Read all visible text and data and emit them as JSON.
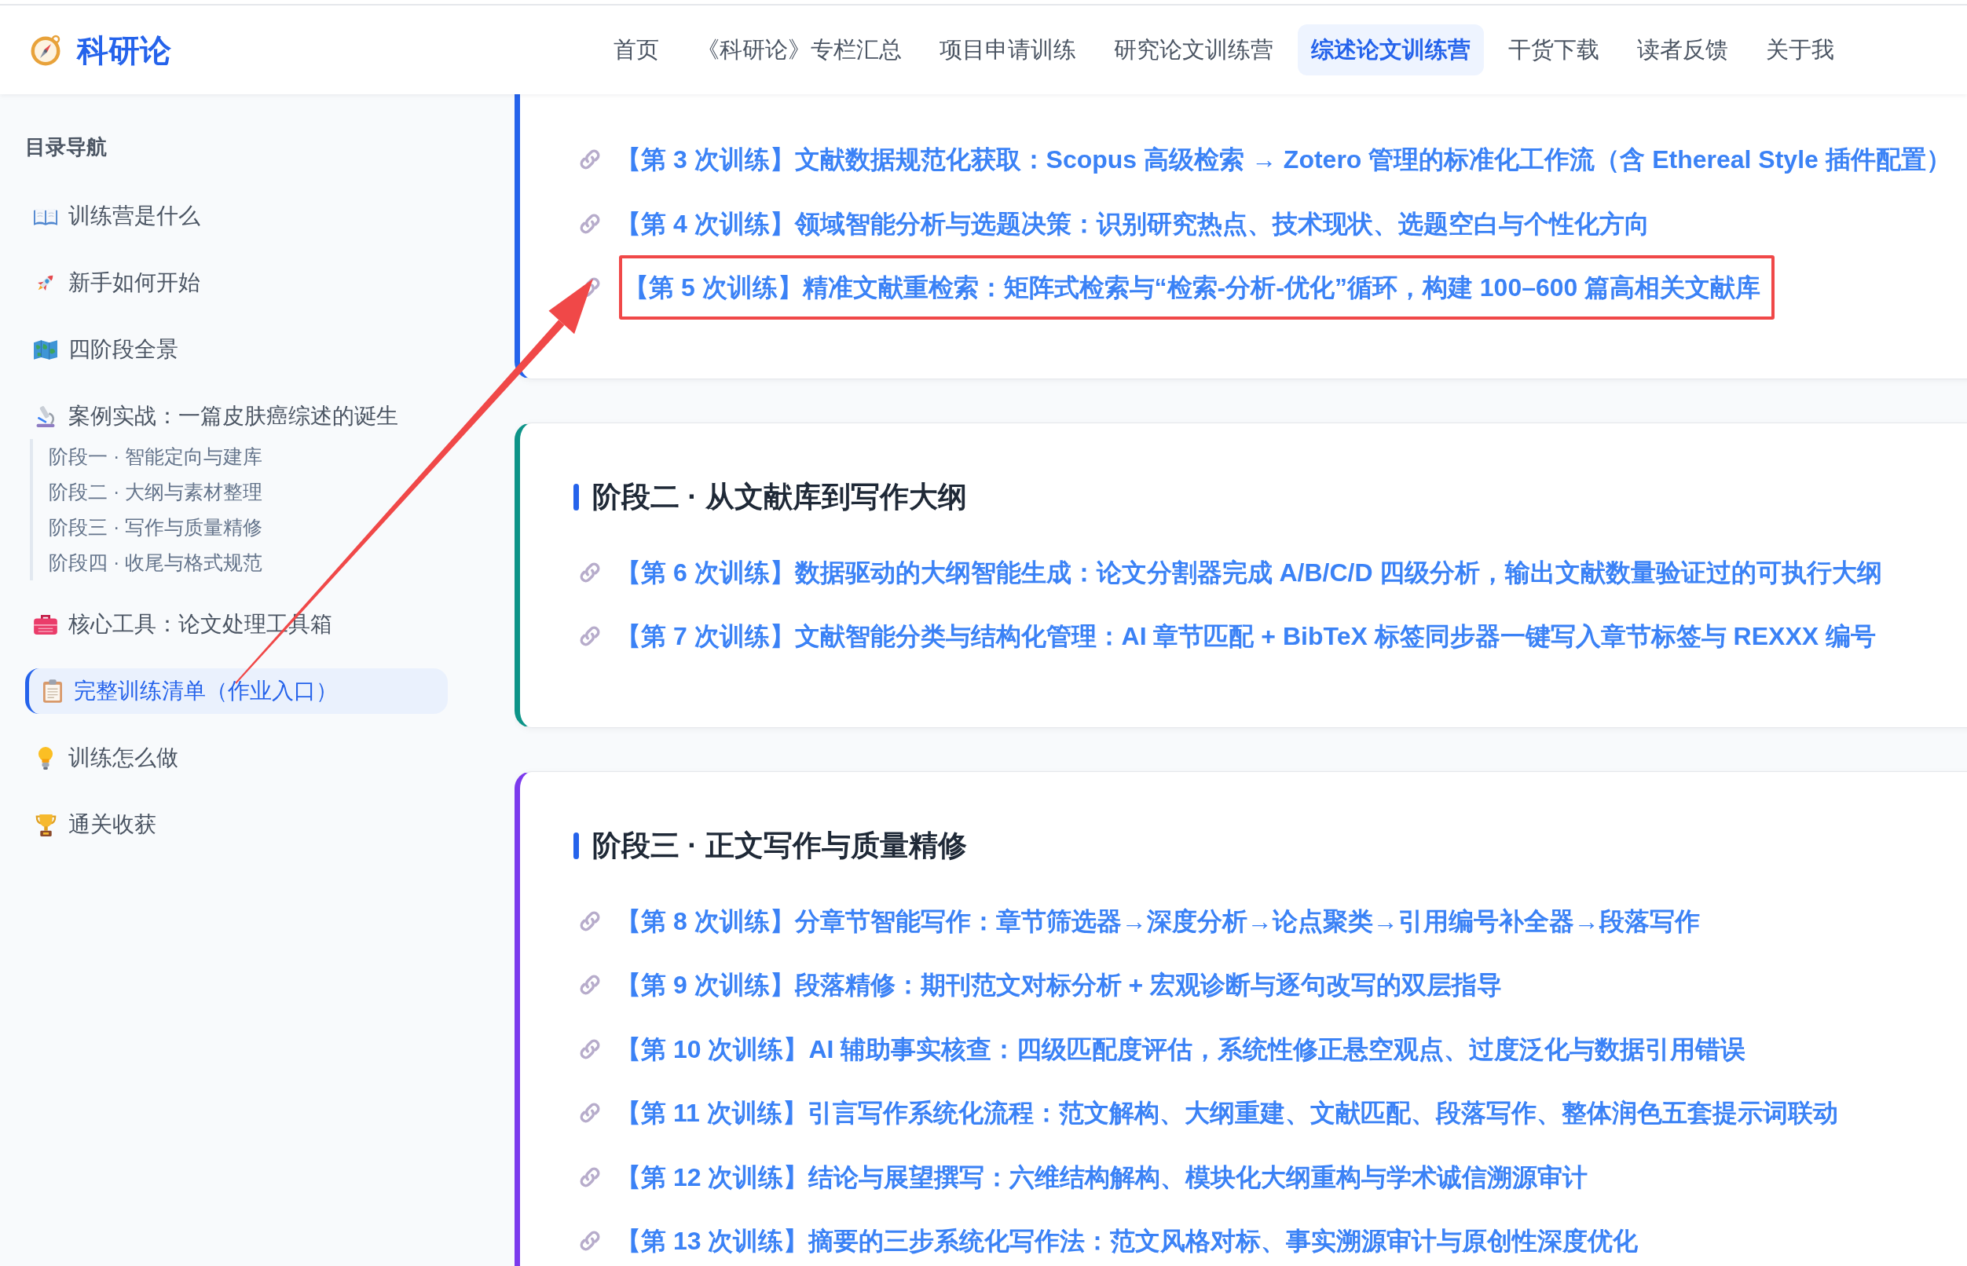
{
  "header": {
    "logo": "科研论",
    "nav": [
      {
        "label": "首页",
        "selected": false
      },
      {
        "label": "《科研论》专栏汇总",
        "selected": false
      },
      {
        "label": "项目申请训练",
        "selected": false
      },
      {
        "label": "研究论文训练营",
        "selected": false
      },
      {
        "label": "综述论文训练营",
        "selected": true
      },
      {
        "label": "干货下载",
        "selected": false
      },
      {
        "label": "读者反馈",
        "selected": false
      },
      {
        "label": "关于我",
        "selected": false
      }
    ]
  },
  "sidebar": {
    "title": "目录导航",
    "items": [
      {
        "label": "训练营是什么",
        "selected": false
      },
      {
        "label": "新手如何开始",
        "selected": false
      },
      {
        "label": "四阶段全景",
        "selected": false
      },
      {
        "label": "案例实战：一篇皮肤癌综述的诞生",
        "selected": false,
        "children": [
          {
            "label": "阶段一 · 智能定向与建库",
            "selected": false
          },
          {
            "label": "阶段二 · 大纲与素材整理",
            "selected": false
          },
          {
            "label": "阶段三 · 写作与质量精修",
            "selected": false
          },
          {
            "label": "阶段四 · 收尾与格式规范",
            "selected": false
          }
        ]
      },
      {
        "label": "核心工具：论文处理工具箱",
        "selected": false
      },
      {
        "label": "完整训练清单（作业入口）",
        "selected": true
      },
      {
        "label": "训练怎么做",
        "selected": false
      },
      {
        "label": "通关收获",
        "selected": false
      }
    ]
  },
  "stages": [
    {
      "color": "#2563eb",
      "links": [
        {
          "text": "【第 3 次训练】文献数据规范化获取：Scopus 高级检索 → Zotero 管理的标准化工作流（含 Ethereal Style 插件配置）",
          "highlighted": false
        },
        {
          "text": "【第 4 次训练】领域智能分析与选题决策：识别研究热点、技术现状、选题空白与个性化方向",
          "highlighted": false
        },
        {
          "text": "【第 5 次训练】精准文献重检索：矩阵式检索与“检索-分析-优化”循环，构建 100–600 篇高相关文献库",
          "highlighted": true
        }
      ]
    },
    {
      "title": "阶段二 · 从文献库到写作大纲",
      "color": "#0d9488",
      "links": [
        {
          "text": "【第 6 次训练】数据驱动的大纲智能生成：论文分割器完成 A/B/C/D 四级分析，输出文献数量验证过的可执行大纲",
          "highlighted": false
        },
        {
          "text": "【第 7 次训练】文献智能分类与结构化管理：AI 章节匹配 + BibTeX 标签同步器一键写入章节标签与 REXXX 编号",
          "highlighted": false
        }
      ]
    },
    {
      "title": "阶段三 · 正文写作与质量精修",
      "color": "#7c3aed",
      "links": [
        {
          "text": "【第 8 次训练】分章节智能写作：章节筛选器→深度分析→论点聚类→引用编号补全器→段落写作",
          "highlighted": false
        },
        {
          "text": "【第 9 次训练】段落精修：期刊范文对标分析 + 宏观诊断与逐句改写的双层指导",
          "highlighted": false
        },
        {
          "text": "【第 10 次训练】AI 辅助事实核查：四级匹配度评估，系统性修正悬空观点、过度泛化与数据引用错误",
          "highlighted": false
        },
        {
          "text": "【第 11 次训练】引言写作系统化流程：范文解构、大纲重建、文献匹配、段落写作、整体润色五套提示词联动",
          "highlighted": false
        },
        {
          "text": "【第 12 次训练】结论与展望撰写：六维结构解构、模块化大纲重构与学术诚信溯源审计",
          "highlighted": false
        },
        {
          "text": "【第 13 次训练】摘要的三步系统化写作法：范文风格对标、事实溯源审计与原创性深度优化",
          "highlighted": false
        }
      ]
    }
  ]
}
